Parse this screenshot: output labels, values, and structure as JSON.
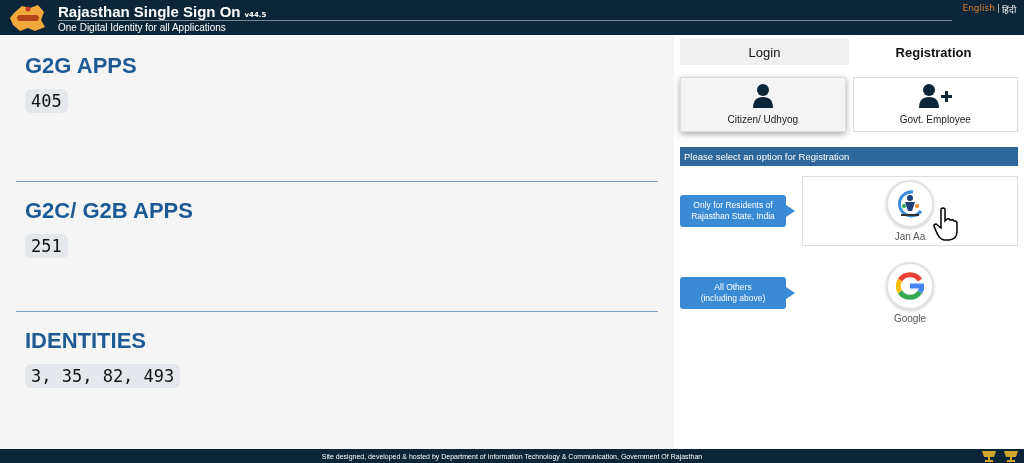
{
  "header": {
    "title": "Rajasthan Single Sign On",
    "version": "v44.5",
    "subtitle": "One Digital Identity for all Applications",
    "language_separator": "|",
    "languages": [
      {
        "label": "English",
        "selected": true
      },
      {
        "label": "हिंदी",
        "selected": false
      }
    ]
  },
  "stats": [
    {
      "title": "G2G APPS",
      "count": "405"
    },
    {
      "title": "G2C/ G2B APPS",
      "count": "251"
    },
    {
      "title": "IDENTITIES",
      "count": "3, 35, 82, 493"
    }
  ],
  "tabs": [
    {
      "label": "Login",
      "selected": false
    },
    {
      "label": "Registration",
      "selected": true
    }
  ],
  "user_types": [
    {
      "label": "Citizen/ Udhyog",
      "kind": "person",
      "selected": true
    },
    {
      "label": "Govt. Employee",
      "kind": "person-add",
      "selected": false
    }
  ],
  "prompt": "Please select an option for Registration",
  "options": [
    {
      "note_lines": [
        "Only for Residents of",
        "Rajasthan State, India"
      ],
      "label": "Jan Aa",
      "kind": "janaadhaar",
      "selected": true
    },
    {
      "note_lines": [
        "All Others",
        "(including above)"
      ],
      "label": "Google",
      "kind": "google",
      "selected": false
    }
  ],
  "footer": "Site designed, developed & hosted by Department of Information Technology & Communication, Government Of Rajasthan"
}
